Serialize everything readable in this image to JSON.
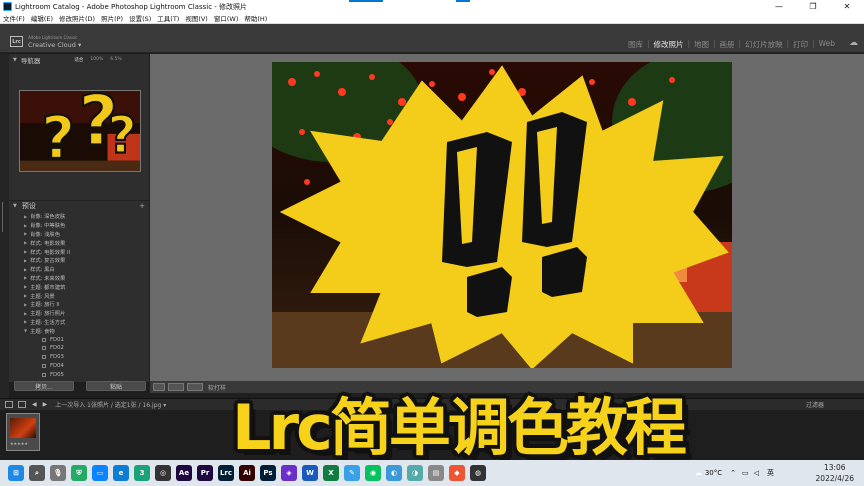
{
  "window": {
    "title": "Lightroom Catalog - Adobe Photoshop Lightroom Classic - 修改照片",
    "minimize": "—",
    "maximize": "❐",
    "close": "✕"
  },
  "menu": [
    "文件(F)",
    "编辑(E)",
    "修改照片(D)",
    "照片(P)",
    "设置(S)",
    "工具(T)",
    "视图(V)",
    "窗口(W)",
    "帮助(H)"
  ],
  "identity": {
    "badge": "Lrc",
    "adobe_line": "Adobe Lightroom Classic",
    "cc_line": "Creative Cloud ▾"
  },
  "modules": [
    "图库",
    "修改照片",
    "地图",
    "画册",
    "幻灯片放映",
    "打印",
    "Web"
  ],
  "active_module": "修改照片",
  "navigator": {
    "label": "导航器",
    "zoom_fit": "适合",
    "zoom_100": "100%",
    "zoom_pct": "6.5%"
  },
  "presets": {
    "label": "预设",
    "plus": "+",
    "items": [
      {
        "label": "肖像: 深色皮肤",
        "sub": false
      },
      {
        "label": "肖像: 中等肤色",
        "sub": false
      },
      {
        "label": "肖像: 浅肤色",
        "sub": false
      },
      {
        "label": "样式: 电影效果",
        "sub": false
      },
      {
        "label": "样式: 电影效果 II",
        "sub": false
      },
      {
        "label": "样式: 复古效果",
        "sub": false
      },
      {
        "label": "样式: 黑白",
        "sub": false
      },
      {
        "label": "样式: 未来效果",
        "sub": false
      },
      {
        "label": "主题: 都市建筑",
        "sub": false
      },
      {
        "label": "主题: 风景",
        "sub": false
      },
      {
        "label": "主题: 旅行 II",
        "sub": false
      },
      {
        "label": "主题: 旅行照片",
        "sub": false
      },
      {
        "label": "主题: 生活方式",
        "sub": false
      },
      {
        "label": "主题: 食物",
        "sub": false
      },
      {
        "label": "FD01",
        "sub": true
      },
      {
        "label": "FD02",
        "sub": true
      },
      {
        "label": "FD03",
        "sub": true
      },
      {
        "label": "FD04",
        "sub": true
      },
      {
        "label": "FD05",
        "sub": true
      }
    ]
  },
  "left_buttons": {
    "copy": "拷贝...",
    "paste": "粘贴"
  },
  "toolbar": {
    "text": "软打样"
  },
  "filmstrip": {
    "breadcrumb": "上一次导入  1张照片 / 选定1张 / 16.jpg ▾",
    "filter": "过滤器",
    "stars": "★★★★★"
  },
  "overlay_title": "Lrc简单调色教程",
  "taskbar": {
    "apps": [
      {
        "name": "windows-start-icon",
        "label": "⊞",
        "color": "#1e88e5"
      },
      {
        "name": "search-icon",
        "label": "⌕",
        "color": "#555"
      },
      {
        "name": "mic-icon",
        "label": "🎙",
        "color": "#777"
      },
      {
        "name": "shield-icon",
        "label": "⛨",
        "color": "#2a6"
      },
      {
        "name": "remote-icon",
        "label": "▭",
        "color": "#0a84ff"
      },
      {
        "name": "edge-icon",
        "label": "e",
        "color": "#0c7cd5"
      },
      {
        "name": "app3-icon",
        "label": "3",
        "color": "#1aa37a"
      },
      {
        "name": "dvd-icon",
        "label": "◎",
        "color": "#333"
      },
      {
        "name": "after-effects-icon",
        "label": "Ae",
        "color": "#1f0740"
      },
      {
        "name": "premiere-icon",
        "label": "Pr",
        "color": "#1f0740"
      },
      {
        "name": "lightroom-icon",
        "label": "Lrc",
        "color": "#001e36"
      },
      {
        "name": "illustrator-icon",
        "label": "Ai",
        "color": "#330000"
      },
      {
        "name": "photoshop-icon",
        "label": "Ps",
        "color": "#001e36"
      },
      {
        "name": "app-icon",
        "label": "◈",
        "color": "#6a2ec9"
      },
      {
        "name": "word-icon",
        "label": "W",
        "color": "#185abd"
      },
      {
        "name": "excel-icon",
        "label": "X",
        "color": "#107c41"
      },
      {
        "name": "app2-icon",
        "label": "✎",
        "color": "#3aa0e8"
      },
      {
        "name": "wechat-icon",
        "label": "◉",
        "color": "#07c160"
      },
      {
        "name": "app4-icon",
        "label": "◐",
        "color": "#3a9ad9"
      },
      {
        "name": "app5-icon",
        "label": "◑",
        "color": "#5aa"
      },
      {
        "name": "app6-icon",
        "label": "▤",
        "color": "#888"
      },
      {
        "name": "app7-icon",
        "label": "◆",
        "color": "#e53"
      },
      {
        "name": "davinci-icon",
        "label": "◍",
        "color": "#333"
      }
    ],
    "weather": "30°C",
    "ime": "英",
    "time": "13:06",
    "date": "2022/4/26"
  }
}
